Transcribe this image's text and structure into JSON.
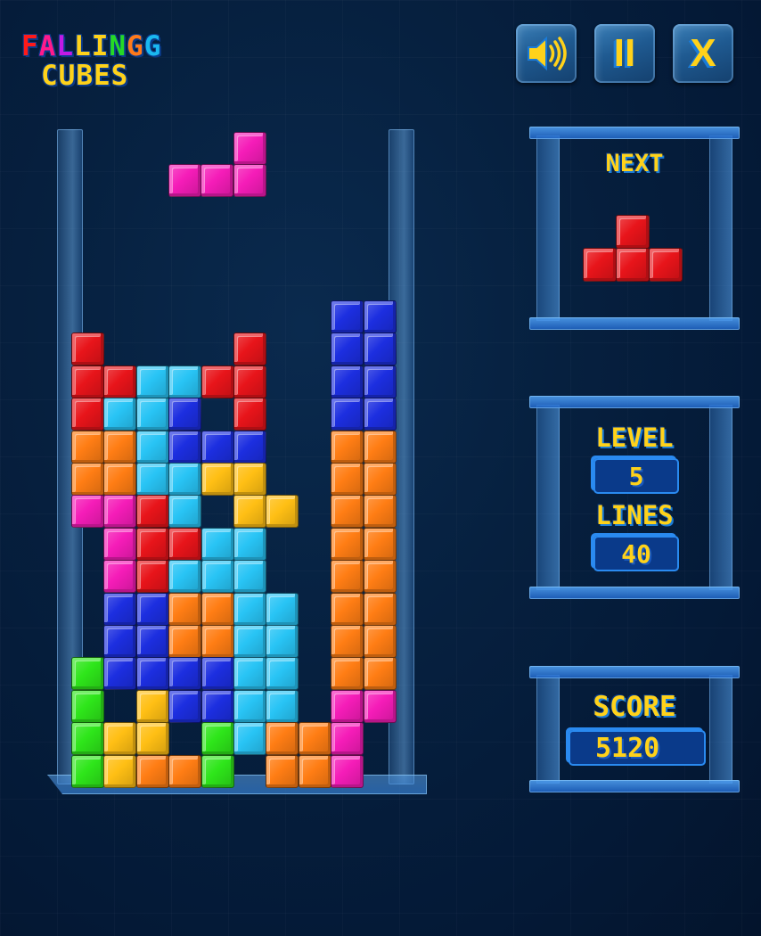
{
  "logo": {
    "line1": [
      {
        "ch": "F",
        "color": "#ff1a1a"
      },
      {
        "ch": "A",
        "color": "#ff1a8c"
      },
      {
        "ch": "L",
        "color": "#c21ae6"
      },
      {
        "ch": "L",
        "color": "#ffd21a"
      },
      {
        "ch": "I",
        "color": "#ffd21a"
      },
      {
        "ch": "N",
        "color": "#26d926"
      },
      {
        "ch": "G",
        "color": "#ff7a1a"
      },
      {
        "ch": "",
        "color": "#1ac2f0"
      }
    ],
    "line1_last": {
      "ch": "G",
      "color": "#1ab8f0"
    },
    "line2": "CUBES",
    "line2_color": "#ffd21a"
  },
  "toolbar": {
    "sound": {
      "icon": "speaker-icon",
      "label": "Sound"
    },
    "pause": {
      "icon": "pause-icon",
      "glyph": "II"
    },
    "close": {
      "icon": "close-icon",
      "glyph": "X"
    }
  },
  "colors": {
    "R": "#e8141a",
    "O": "#ff7d14",
    "Y": "#ffbf14",
    "G": "#2ee61a",
    "C": "#28c4f5",
    "B": "#1c2ee0",
    "M": "#f51cb8"
  },
  "board": {
    "columns": 10,
    "rows_top_to_bottom": [
      "........BB",
      "R....R..BB",
      "RRCCRR..BB",
      "RCCB.R..BB",
      "OOCBBB..OO",
      "OOCCYY..OO",
      "MMRC.YY.OO",
      ".MRRCC..OO",
      ".MRCCC..OO",
      ".BBOOCC.OO",
      ".BBOOCC.OO",
      "GBBBBCC.OO",
      "G.YBBCC.MM",
      "GYY.GCOOM.",
      "GYOOG.OOM."
    ],
    "falling_piece": {
      "color": "M",
      "cells_top_to_bottom": [
        "..#",
        "###"
      ]
    }
  },
  "next": {
    "title": "NEXT",
    "color": "R",
    "cells_top_to_bottom": [
      ".#.",
      "###"
    ]
  },
  "stats": {
    "level_label": "LEVEL",
    "level_value": "5",
    "lines_label": "LINES",
    "lines_value": "40",
    "score_label": "SCORE",
    "score_value": "5120"
  }
}
